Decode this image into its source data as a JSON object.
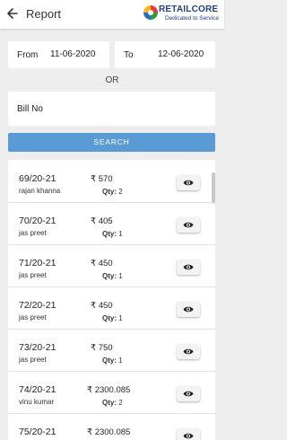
{
  "header": {
    "title": "Report",
    "brand_name": "RETAILCORE",
    "brand_tagline": "Dedicated to Service"
  },
  "filters": {
    "from_label": "From",
    "from_value": "11-06-2020",
    "to_label": "To",
    "to_value": "12-06-2020",
    "or_label": "OR",
    "bill_no_placeholder": "Bill No",
    "search_label": "SEARCH"
  },
  "currency_symbol": "₹",
  "qty_label": "Qty:",
  "bills": [
    {
      "bill_no": "69/20-21",
      "customer": "rajan khanna",
      "amount": "570",
      "qty": "2"
    },
    {
      "bill_no": "70/20-21",
      "customer": "jas preet",
      "amount": "405",
      "qty": "1"
    },
    {
      "bill_no": "71/20-21",
      "customer": "jas preet",
      "amount": "450",
      "qty": "1"
    },
    {
      "bill_no": "72/20-21",
      "customer": "jas preet",
      "amount": "450",
      "qty": "1"
    },
    {
      "bill_no": "73/20-21",
      "customer": "jas preet",
      "amount": "750",
      "qty": "1"
    },
    {
      "bill_no": "74/20-21",
      "customer": "vinu kumar",
      "amount": "2300.085",
      "qty": "2"
    },
    {
      "bill_no": "75/20-21",
      "customer": "",
      "amount": "2300.085",
      "qty": ""
    }
  ]
}
